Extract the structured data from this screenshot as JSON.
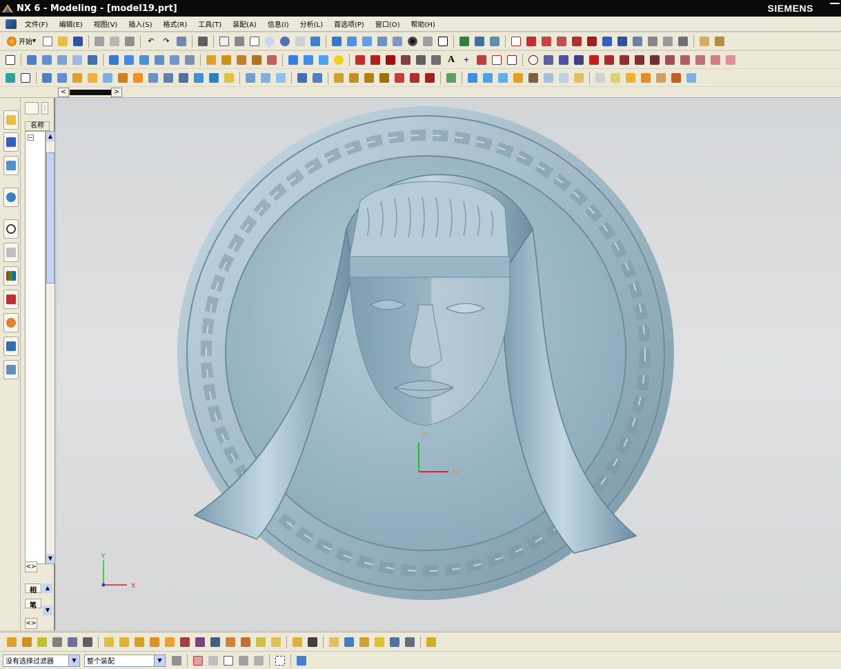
{
  "window": {
    "title": "NX 6 - Modeling - [model19.prt]",
    "brand": "SIEMENS"
  },
  "menu": {
    "items": [
      "文件(F)",
      "编辑(E)",
      "视图(V)",
      "插入(S)",
      "格式(R)",
      "工具(T)",
      "装配(A)",
      "信息(I)",
      "分析(L)",
      "首选项(P)",
      "窗口(O)",
      "帮助(H)"
    ]
  },
  "toolbar": {
    "start_label": "开始"
  },
  "navigator": {
    "column_header": "名称",
    "bottom_labels": [
      "相",
      "笔"
    ]
  },
  "viewport": {
    "wcs_x_label": "XC",
    "wcs_y_label": "YC",
    "abs_x_label": "X",
    "abs_y_label": "Y"
  },
  "statusbar": {
    "filter_value": "没有选择过滤器",
    "scope_value": "整个装配"
  },
  "colors": {
    "model": "#9bb9c8",
    "background": "#dcdedf",
    "chrome": "#ece9d8"
  }
}
